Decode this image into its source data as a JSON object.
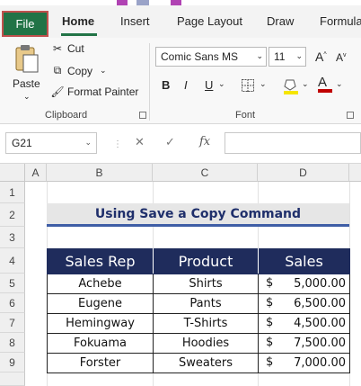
{
  "ribbon_tabs": {
    "file": "File",
    "home": "Home",
    "insert": "Insert",
    "page_layout": "Page Layout",
    "draw": "Draw",
    "formulas": "Formula"
  },
  "clipboard": {
    "paste": "Paste",
    "cut": "Cut",
    "copy": "Copy",
    "format_painter": "Format Painter",
    "group_label": "Clipboard"
  },
  "font": {
    "font_name": "Comic Sans MS",
    "font_size": "11",
    "grow": "A",
    "shrink": "A",
    "bold": "B",
    "italic": "I",
    "underline": "U",
    "font_color_letter": "A",
    "group_label": "Font"
  },
  "formula_bar": {
    "name_box": "G21",
    "cancel": "✕",
    "enter": "✓",
    "fx": "fx",
    "value": ""
  },
  "columns": [
    "A",
    "B",
    "C",
    "D"
  ],
  "rows": [
    "1",
    "2",
    "3",
    "4",
    "5",
    "6",
    "7",
    "8",
    "9"
  ],
  "sheet": {
    "title": "Using Save a Copy Command",
    "headers": [
      "Sales Rep",
      "Product",
      "Sales"
    ],
    "records": [
      {
        "rep": "Achebe",
        "product": "Shirts",
        "currency": "$",
        "sales": "5,000.00"
      },
      {
        "rep": "Eugene",
        "product": "Pants",
        "currency": "$",
        "sales": "6,500.00"
      },
      {
        "rep": "Hemingway",
        "product": "T-Shirts",
        "currency": "$",
        "sales": "4,500.00"
      },
      {
        "rep": "Fokuama",
        "product": "Hoodies",
        "currency": "$",
        "sales": "7,500.00"
      },
      {
        "rep": "Forster",
        "product": "Sweaters",
        "currency": "$",
        "sales": "7,000.00"
      }
    ]
  },
  "colors": {
    "file_tab": "#217346",
    "header_fill": "#1f2c5c",
    "title_underline": "#3f5ea6"
  }
}
